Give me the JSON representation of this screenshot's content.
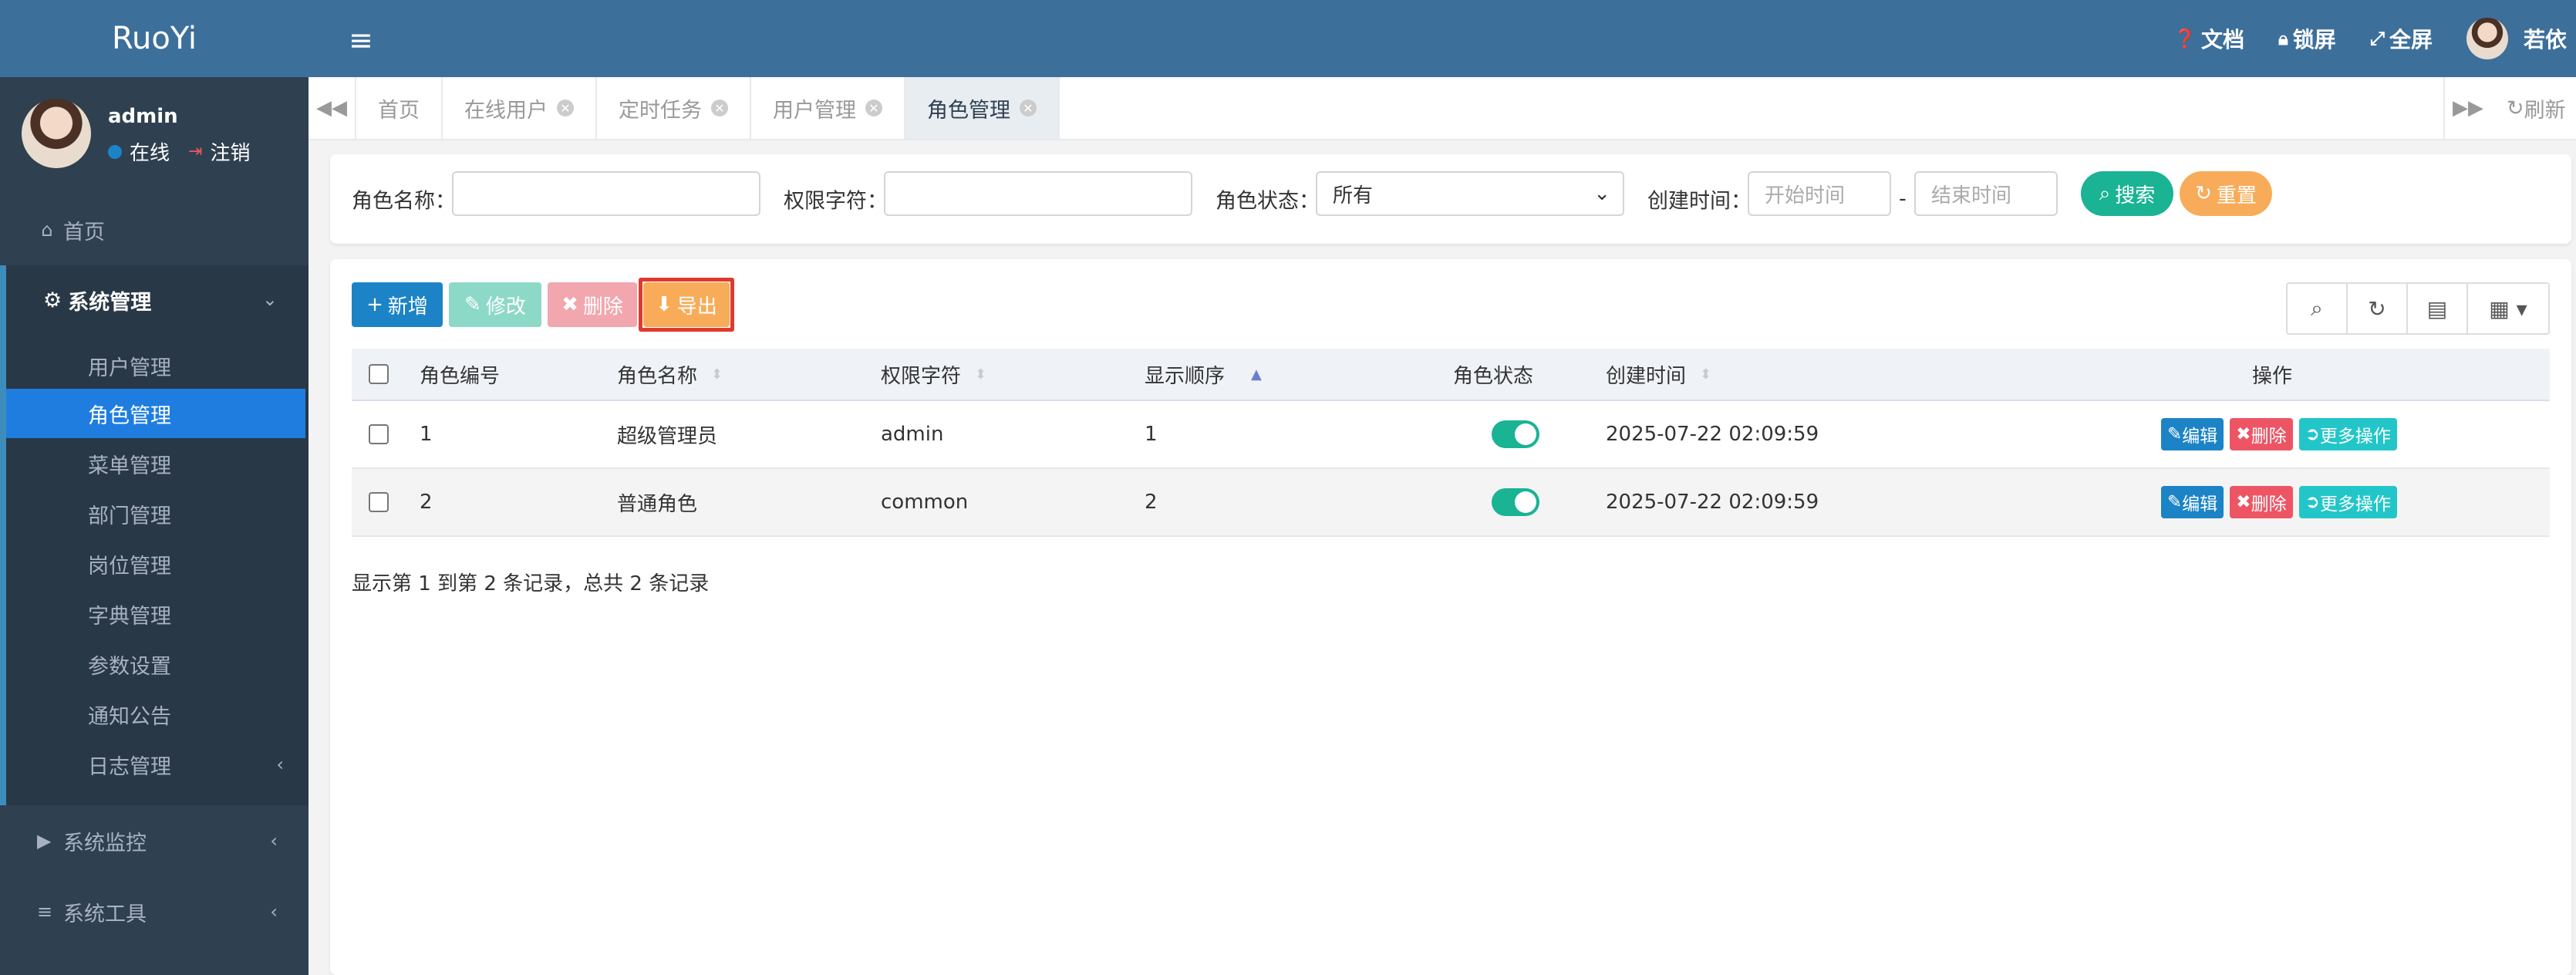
{
  "brand": "RuoYi",
  "user": {
    "name": "admin",
    "status": "在线",
    "logout": "注销"
  },
  "nav": {
    "home": "首页",
    "system": "系统管理",
    "system_items": [
      "用户管理",
      "角色管理",
      "菜单管理",
      "部门管理",
      "岗位管理",
      "字典管理",
      "参数设置",
      "通知公告",
      "日志管理"
    ],
    "monitor": "系统监控",
    "tools": "系统工具"
  },
  "header": {
    "docs": "文档",
    "lock": "锁屏",
    "fullscreen": "全屏",
    "username": "若依"
  },
  "tabs": [
    {
      "label": "首页",
      "closable": false
    },
    {
      "label": "在线用户",
      "closable": true
    },
    {
      "label": "定时任务",
      "closable": true
    },
    {
      "label": "用户管理",
      "closable": true
    },
    {
      "label": "角色管理",
      "closable": true,
      "active": true
    }
  ],
  "refresh": "刷新",
  "search": {
    "role_name_label": "角色名称：",
    "role_key_label": "权限字符：",
    "role_status_label": "角色状态：",
    "role_status_value": "所有",
    "create_time_label": "创建时间：",
    "start_placeholder": "开始时间",
    "end_placeholder": "结束时间",
    "dash": "-",
    "search_btn": "搜索",
    "reset_btn": "重置"
  },
  "toolbar": {
    "add": "新增",
    "edit": "修改",
    "delete": "删除",
    "export": "导出"
  },
  "table": {
    "headers": [
      "角色编号",
      "角色名称",
      "权限字符",
      "显示顺序",
      "角色状态",
      "创建时间",
      "操作"
    ],
    "rows": [
      {
        "id": "1",
        "name": "超级管理员",
        "key": "admin",
        "order": "1",
        "enabled": true,
        "created": "2025-07-22 02:09:59"
      },
      {
        "id": "2",
        "name": "普通角色",
        "key": "common",
        "order": "2",
        "enabled": true,
        "created": "2025-07-22 02:09:59"
      }
    ],
    "actions": {
      "edit": "编辑",
      "delete": "删除",
      "more": "更多操作"
    }
  },
  "summary": "显示第 1 到第 2 条记录，总共 2 条记录",
  "colors": {
    "header": "#3d6f9b",
    "sidebar": "#2f4050",
    "active_menu": "#1f7de0",
    "primary": "#1c84c6",
    "success": "#1ab394",
    "warning": "#f8ac59",
    "danger": "#ed5565",
    "info": "#23c6c8"
  }
}
